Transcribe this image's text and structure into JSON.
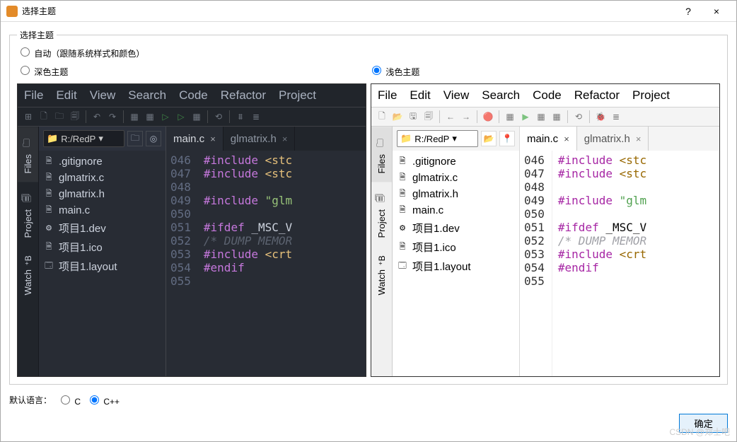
{
  "window": {
    "title": "选择主题",
    "help": "?",
    "close": "×"
  },
  "group_legend": "选择主题",
  "radios": {
    "auto": "自动（跟随系统样式和颜色）",
    "dark": "深色主题",
    "light": "浅色主题",
    "selected": "light"
  },
  "menubar": [
    "File",
    "Edit",
    "View",
    "Search",
    "Code",
    "Refactor",
    "Project"
  ],
  "toolbar_dark": [
    "⊞",
    "🗋",
    "🗀",
    "🗐",
    "|",
    "↶",
    "↷",
    "|",
    "▦",
    "▦",
    "▷",
    "▷",
    "▦",
    "|",
    "⟲",
    "|",
    "⩩",
    "≣"
  ],
  "toolbar_light": [
    "🗋",
    "📂",
    "🖫",
    "🗐",
    "|",
    "←",
    "→",
    "|",
    "🔴",
    "|",
    "▦",
    "▶",
    "▦",
    "▦",
    "|",
    "⟲",
    "|",
    "🐞",
    "≣"
  ],
  "path": "R:/RedP",
  "sidetabs": [
    {
      "label": "Files",
      "icon": "🗀",
      "active": true
    },
    {
      "label": "Project",
      "icon": "🗐",
      "active": false
    },
    {
      "label": "Watch",
      "icon": "⁺B",
      "active": false
    }
  ],
  "files": [
    {
      "name": ".gitignore",
      "icon": "file"
    },
    {
      "name": "glmatrix.c",
      "icon": "c"
    },
    {
      "name": "glmatrix.h",
      "icon": "h"
    },
    {
      "name": "main.c",
      "icon": "c"
    },
    {
      "name": "项目1.dev",
      "icon": "dev"
    },
    {
      "name": "项目1.ico",
      "icon": "ico"
    },
    {
      "name": "项目1.layout",
      "icon": "layout"
    }
  ],
  "editor_tabs": [
    {
      "label": "main.c",
      "active": true
    },
    {
      "label": "glmatrix.h",
      "active": false
    }
  ],
  "code_lines": [
    {
      "n": "046",
      "tokens": [
        [
          "kw",
          "#include "
        ],
        [
          "ang",
          "<stc"
        ]
      ]
    },
    {
      "n": "047",
      "tokens": [
        [
          "kw",
          "#include "
        ],
        [
          "ang",
          "<stc"
        ]
      ]
    },
    {
      "n": "048",
      "tokens": [
        [
          "",
          ""
        ]
      ]
    },
    {
      "n": "049",
      "tokens": [
        [
          "kw",
          "#include "
        ],
        [
          "str",
          "\"glm"
        ]
      ]
    },
    {
      "n": "050",
      "tokens": [
        [
          "",
          ""
        ]
      ]
    },
    {
      "n": "051",
      "tokens": [
        [
          "kw",
          "#ifdef "
        ],
        [
          "",
          "_MSC_V"
        ]
      ]
    },
    {
      "n": "052",
      "tokens": [
        [
          "cm",
          "/* DUMP MEMOR"
        ]
      ]
    },
    {
      "n": "053",
      "tokens": [
        [
          "kw",
          "#include "
        ],
        [
          "ang",
          "<crt"
        ]
      ]
    },
    {
      "n": "054",
      "tokens": [
        [
          "kw",
          "#endif"
        ]
      ]
    },
    {
      "n": "055",
      "tokens": [
        [
          "",
          ""
        ]
      ]
    }
  ],
  "default_lang": {
    "label": "默认语言：",
    "c": "C",
    "cpp": "C++",
    "selected": "cpp"
  },
  "ok_button": "确定",
  "watermark": "CSDN @郑士吧"
}
